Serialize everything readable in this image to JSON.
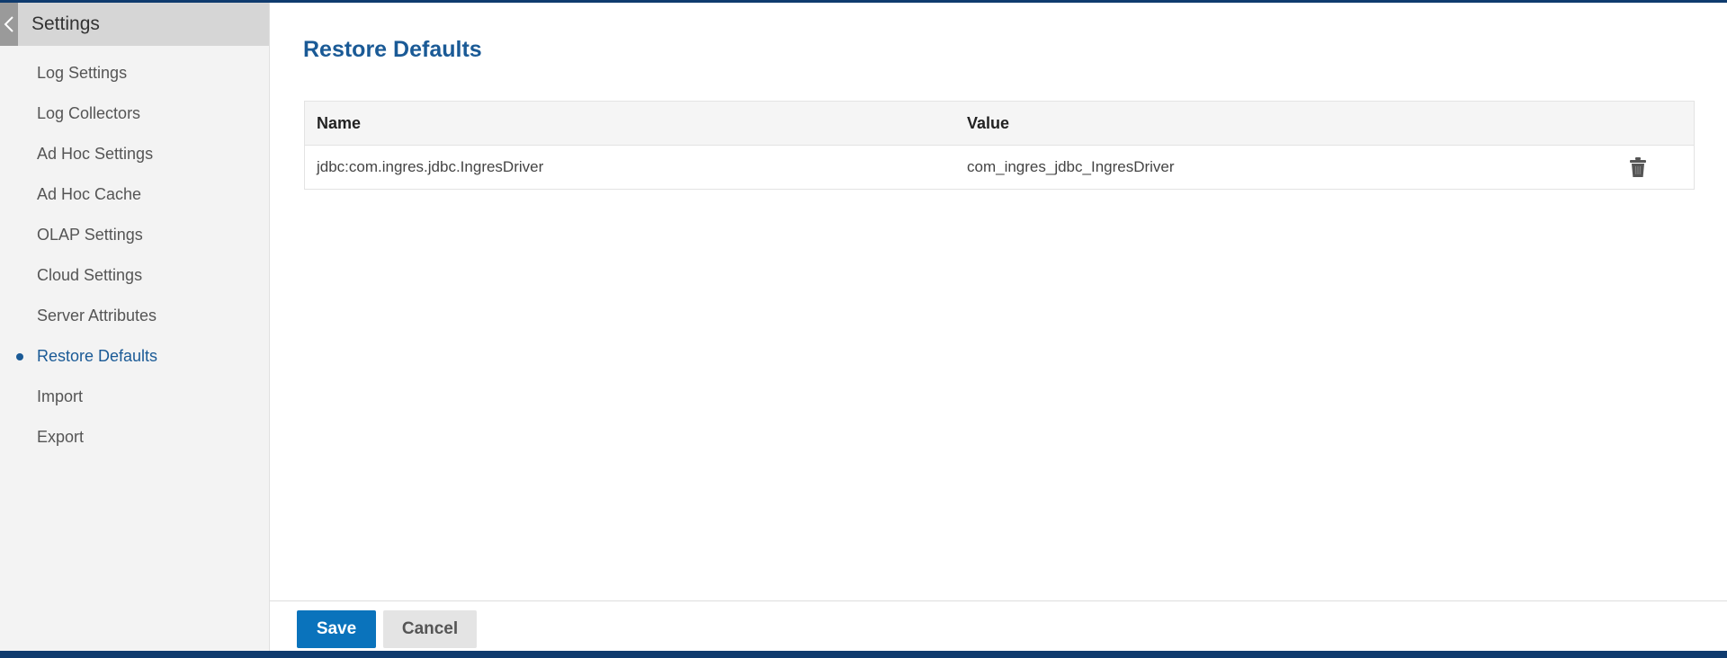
{
  "colors": {
    "accent": "#1a5a96",
    "primary_button": "#0a73bc",
    "top_bar": "#0f3b6e",
    "sidebar_bg": "#f3f3f3"
  },
  "sidebar": {
    "title": "Settings",
    "back_icon": "chevron-left-icon",
    "items": [
      {
        "label": "Log Settings",
        "active": false
      },
      {
        "label": "Log Collectors",
        "active": false
      },
      {
        "label": "Ad Hoc Settings",
        "active": false
      },
      {
        "label": "Ad Hoc Cache",
        "active": false
      },
      {
        "label": "OLAP Settings",
        "active": false
      },
      {
        "label": "Cloud Settings",
        "active": false
      },
      {
        "label": "Server Attributes",
        "active": false
      },
      {
        "label": "Restore Defaults",
        "active": true
      },
      {
        "label": "Import",
        "active": false
      },
      {
        "label": "Export",
        "active": false
      }
    ]
  },
  "main": {
    "title": "Restore Defaults",
    "table": {
      "columns": [
        "Name",
        "Value"
      ],
      "rows": [
        {
          "name": "jdbc:com.ingres.jdbc.IngresDriver",
          "value": "com_ingres_jdbc_IngresDriver",
          "action_icon": "trash-icon"
        }
      ]
    }
  },
  "footer": {
    "save_label": "Save",
    "cancel_label": "Cancel"
  }
}
